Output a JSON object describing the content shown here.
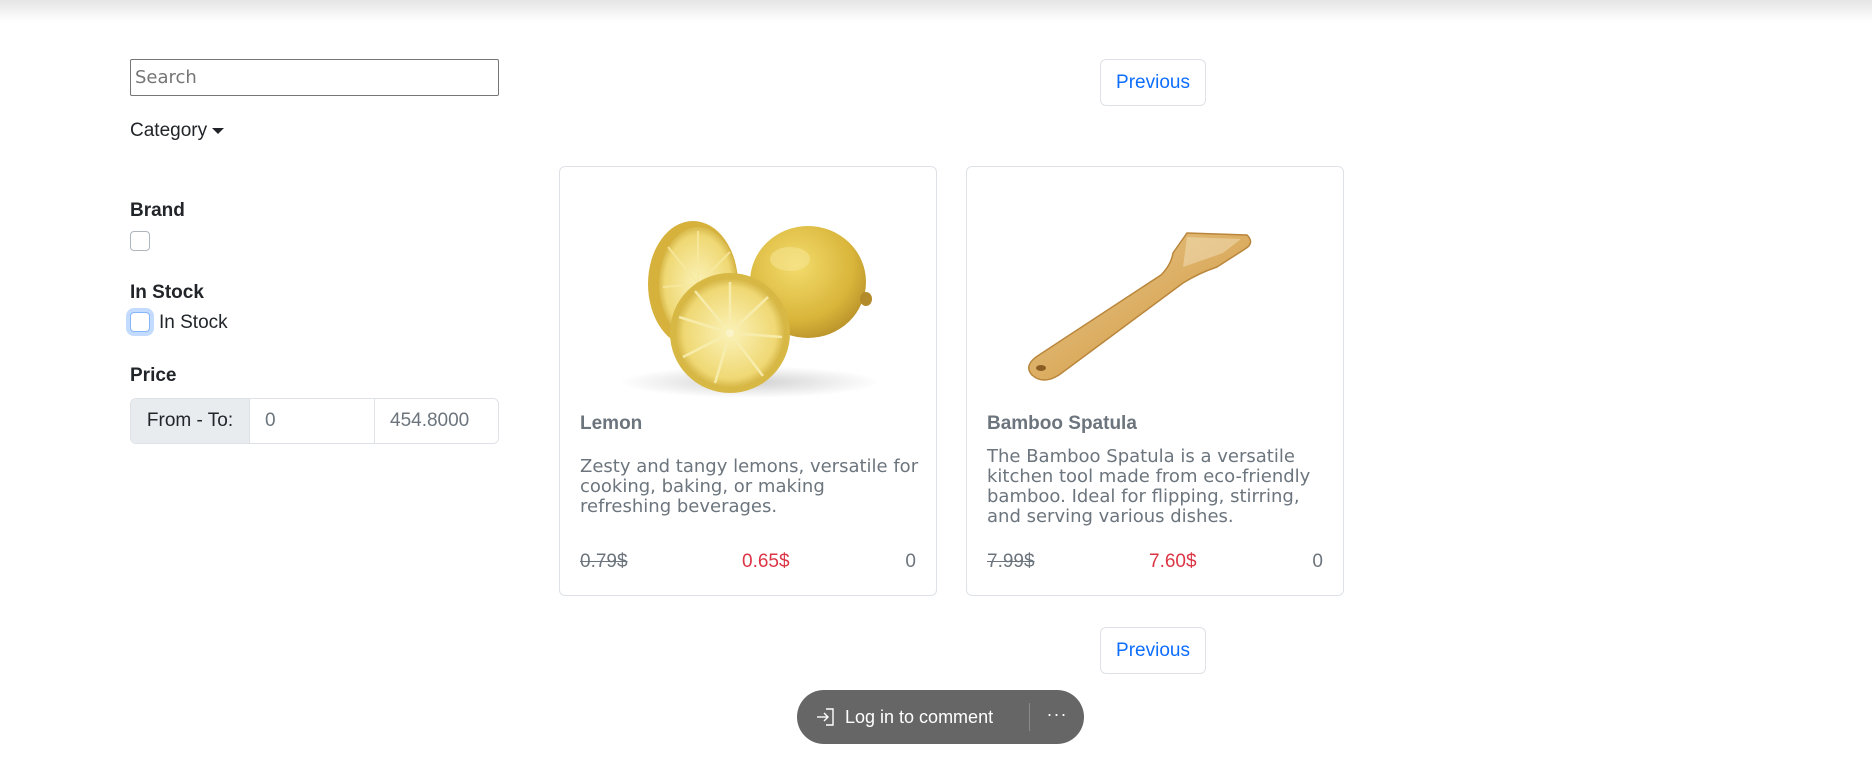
{
  "search": {
    "placeholder": "Search"
  },
  "filters": {
    "category_label": "Category",
    "brand_heading": "Brand",
    "in_stock_heading": "In Stock",
    "in_stock_label": "In Stock",
    "price_heading": "Price",
    "price_addon": "From - To:",
    "price_from": "0",
    "price_to": "454.8000"
  },
  "pagination": {
    "top_label": "Previous",
    "bottom_label": "Previous"
  },
  "products": [
    {
      "title": "Lemon",
      "description": "Zesty and tangy lemons, versatile for cooking, baking, or making refreshing beverages.",
      "old_price": "0.79$",
      "new_price": "0.65$",
      "stock": "0",
      "image": "lemon-image"
    },
    {
      "title": "Bamboo Spatula",
      "description": "The Bamboo Spatula is a versatile kitchen tool made from eco-friendly bamboo. Ideal for flipping, stirring, and serving various dishes.",
      "old_price": "7.99$",
      "new_price": "7.60$",
      "stock": "0",
      "image": "spatula-image"
    }
  ],
  "comment_bar": {
    "login_label": "Log in to comment",
    "more_label": "···",
    "login_icon": "sign-in-icon",
    "more_icon": "ellipsis-icon"
  },
  "colors": {
    "link": "#0d6efd",
    "discount": "#dc3545",
    "muted": "#6c757d",
    "pill": "#666666"
  }
}
